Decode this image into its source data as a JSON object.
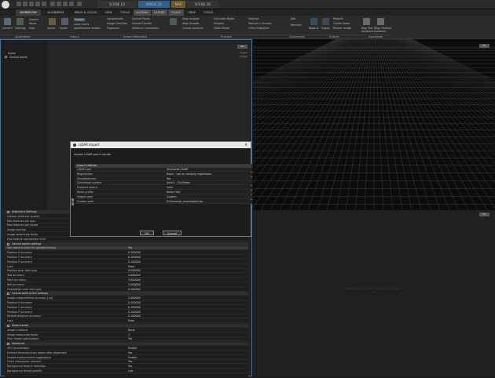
{
  "docTabs": [
    "SCENE 1D",
    "IMAGE 2D",
    "MAP",
    "SCENE 2D"
  ],
  "ribbonTabs": [
    "WORKFLOW",
    "ALIGNMENT",
    "MESH & COLOR",
    "VIEW",
    "TOOLS",
    "CLIPPING",
    "EXPORT",
    "SCALE",
    "VIEW",
    "TOOLS"
  ],
  "ribbon": {
    "groups": [
      "Application",
      "Inputs",
      "Import Metadata",
      "Process",
      "Commands",
      "Output",
      "Assistants"
    ],
    "app": [
      "Camera",
      "Settings",
      "Help",
      "Launch",
      "Reset"
    ],
    "inputs": [
      "Inputs",
      "Folder",
      "Images",
      "Laser scans",
      "Lidar",
      "Add/Remove images"
    ],
    "meta": [
      "Components",
      "Image Direction",
      "Trajectory",
      "Control Points",
      "Ground Control",
      "Distance Constraints"
    ],
    "process": [
      "Align Images",
      "Align Images",
      "Quality Analysis",
      "Calculate Model",
      "Simplify",
      "Clean Model",
      "Colorize",
      "Texture & Unwrap",
      "Ortho Projection"
    ],
    "commands": [
      "Add",
      "Remove"
    ],
    "output": [
      "Reports",
      "Export",
      "Create Video",
      "Render Image"
    ],
    "assistants": [
      "Map Tool",
      "Assistant",
      "Align Multiple",
      "Assistant"
    ]
  },
  "tree": {
    "items": [
      "Scene",
      "Control points"
    ]
  },
  "workspace": {
    "tag": "2D",
    "text1": "Layout",
    "text2": "Image"
  },
  "rightView": {
    "tag": "3D",
    "tag2": "2D",
    "placeholder": "Drag a 2D view image onto the panel to view it"
  },
  "properties": [
    {
      "type": "section",
      "name": "Alignment Settings"
    },
    {
      "name": "Feature detection quality",
      "value": ""
    },
    {
      "name": "Max features per mpx",
      "value": ""
    },
    {
      "name": "Max features per image",
      "value": ""
    },
    {
      "name": "Image overlap",
      "value": ""
    },
    {
      "name": "Image downscale factor",
      "value": ""
    },
    {
      "name": "Max feature reprojection error",
      "value": ""
    },
    {
      "type": "section",
      "name": "Control points settings"
    },
    {
      "name": "Use camera priors for georeferencing",
      "value": "Yes",
      "selected": true
    },
    {
      "name": "Position X accuracy",
      "value": "0.100000"
    },
    {
      "name": "Position Y accuracy",
      "value": "0.100000"
    },
    {
      "name": "Position Z accuracy",
      "value": "0.100000"
    },
    {
      "name": "Lock",
      "value": "False"
    },
    {
      "name": "Position prior lock type",
      "value": "0.500000"
    },
    {
      "name": "Yaw accuracy",
      "value": "3.000000"
    },
    {
      "name": "Pitch accuracy",
      "value": "3.000000"
    },
    {
      "name": "Roll accuracy",
      "value": "3.000000"
    },
    {
      "name": "Orientation prior lock type",
      "value": "0.200000"
    },
    {
      "type": "section",
      "name": "Control point priors settings"
    },
    {
      "name": "Image measurement accuracy [px]",
      "value": "2.000000"
    },
    {
      "name": "Position X accuracy",
      "value": "0.100000"
    },
    {
      "name": "Position Y accuracy",
      "value": "0.100000"
    },
    {
      "name": "Position Z accuracy",
      "value": "0.100000"
    },
    {
      "name": "Default distance accuracy",
      "value": "0.100000"
    },
    {
      "name": "Lock",
      "value": "False"
    },
    {
      "type": "section",
      "name": "Detail Levels"
    },
    {
      "name": "Image undistort",
      "value": "None"
    },
    {
      "name": "Image downscale factor",
      "value": "1"
    },
    {
      "name": "Prior model optimization",
      "value": "Yes"
    },
    {
      "type": "section",
      "name": "Advanced"
    },
    {
      "name": "GPU acceleration",
      "value": "Enable"
    },
    {
      "name": "Defined reconstruction region after alignment",
      "value": "Yes"
    },
    {
      "name": "Enable measurement suggestions",
      "value": "Enable"
    },
    {
      "name": "Force component rematch",
      "value": "Yes"
    },
    {
      "name": "Background feature detection",
      "value": "Yes"
    },
    {
      "name": "Background thread priority",
      "value": "Low"
    }
  ],
  "dialog": {
    "title": "LiDAR Import",
    "subtitle": "Import LiDAR point clouds",
    "tableHeader": "Import settings",
    "rows": [
      {
        "name": "LiDAR type",
        "value": "Terrestrial LiDAR"
      },
      {
        "name": "Registration",
        "value": "Exact - use an existing registration"
      },
      {
        "name": "Georeferenced",
        "value": "Yes"
      },
      {
        "name": "Coordinate system",
        "value": "local:1 - Euclidean"
      },
      {
        "name": "Features source",
        "value": "Color"
      },
      {
        "name": "Noise profile",
        "value": "Noise Free"
      },
      {
        "name": "Output path",
        "value": "Custom"
      },
      {
        "name": "Custom path",
        "value": "D:\\Scans\\lio_tutorial\\pts\\Ldp"
      }
    ],
    "ok": "OK",
    "cancel": "Cancel"
  },
  "colors": {
    "accent": "#3a6fb0",
    "dialogTitleBg": "#e8e8e8"
  }
}
